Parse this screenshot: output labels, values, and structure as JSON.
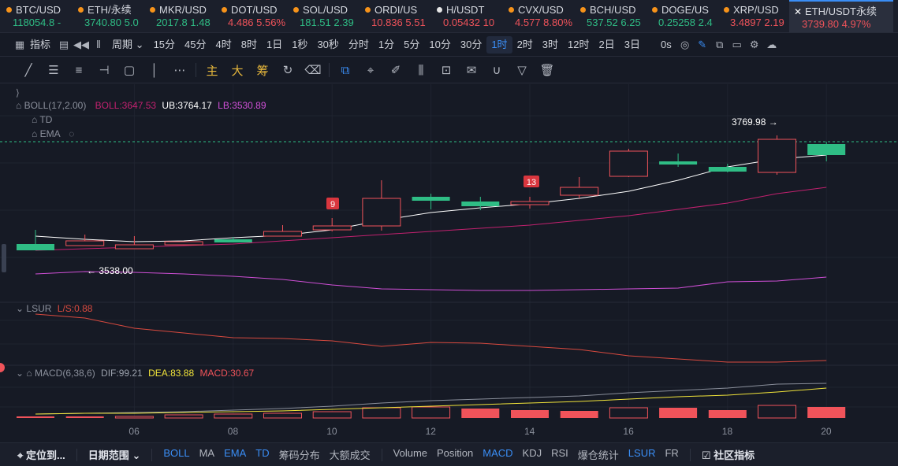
{
  "tickers": [
    {
      "name": "BTC/USD",
      "price": "118054.8 -",
      "dir": "up"
    },
    {
      "name": "ETH/永续",
      "price": "3740.80 5.0",
      "dir": "up"
    },
    {
      "name": "MKR/USD",
      "price": "2017.8 1.48",
      "dir": "up"
    },
    {
      "name": "DOT/USD",
      "price": "4.486 5.56%",
      "dir": "dn"
    },
    {
      "name": "SOL/USD",
      "price": "181.51 2.39",
      "dir": "up"
    },
    {
      "name": "ORDI/US",
      "price": "10.836 5.51",
      "dir": "dn"
    },
    {
      "name": "H/USDT",
      "price": "0.05432 10",
      "dir": "dn"
    },
    {
      "name": "CVX/USD",
      "price": "4.577 8.80%",
      "dir": "dn"
    },
    {
      "name": "BCH/USD",
      "price": "537.52 6.25",
      "dir": "up"
    },
    {
      "name": "DOGE/US",
      "price": "0.25258 2.4",
      "dir": "up"
    },
    {
      "name": "XRP/USD",
      "price": "3.4897 2.19",
      "dir": "dn"
    }
  ],
  "active_ticker": {
    "name": "ETH/USDT永续",
    "price": "3739.80 4.97%"
  },
  "toolbar": {
    "indicator_label": "指标",
    "period_label": "周期",
    "intervals": [
      "15分",
      "45分",
      "4时",
      "8时",
      "1日",
      "1秒",
      "30秒",
      "分时",
      "1分",
      "5分",
      "10分",
      "30分",
      "1时",
      "2时",
      "3时",
      "12时",
      "2日",
      "3日"
    ],
    "active_interval": "1时",
    "zero_s": "0s"
  },
  "drawing_tools": {
    "main": "主",
    "big": "大",
    "chip": "筹"
  },
  "chart_legend": {
    "boll_name": "BOLL(17,2.00)",
    "boll_val": "BOLL:3647.53",
    "ub_val": "UB:3764.17",
    "lb_val": "LB:3530.89",
    "td": "TD",
    "ema": "EMA",
    "lsur": "LSUR",
    "ls_val": "L/S:0.88",
    "macd_name": "MACD(6,38,6)",
    "dif_val": "DIF:99.21",
    "dea_val": "DEA:83.88",
    "macd_val": "MACD:30.67",
    "high_label": "3769.98",
    "low_label": "3538.00",
    "td9": "9",
    "td13": "13",
    "x_ticks": [
      "06",
      "08",
      "10",
      "12",
      "14",
      "16",
      "18",
      "20"
    ]
  },
  "colors": {
    "up": "#2fbd85",
    "down": "#f0535a",
    "accent": "#3a8ef6",
    "boll_mid": "#ffffff",
    "boll_ub": "#c2216f",
    "boll_lb": "#cf4fd6",
    "dea": "#f0e33a"
  },
  "candles": [
    {
      "dir": "up",
      "o": 4,
      "c": 12,
      "h": 30,
      "l": 15
    },
    {
      "dir": "dn",
      "o": 10,
      "c": 16,
      "h": 24,
      "l": 40
    },
    {
      "dir": "dn",
      "o": 6,
      "c": 11,
      "h": 22,
      "l": 8
    },
    {
      "dir": "dn",
      "o": 12,
      "c": 15,
      "h": 15,
      "l": 25
    },
    {
      "dir": "up",
      "o": 18,
      "c": 16,
      "h": 21,
      "l": 26
    },
    {
      "dir": "dn",
      "o": 22,
      "c": 28,
      "h": 36,
      "l": 24
    },
    {
      "dir": "dn",
      "o": 30,
      "c": 35,
      "h": 45,
      "l": 28
    },
    {
      "dir": "dn",
      "o": 35,
      "c": 70,
      "h": 93,
      "l": 29
    },
    {
      "dir": "up",
      "o": 72,
      "c": 67,
      "h": 76,
      "l": 56
    },
    {
      "dir": "up",
      "o": 66,
      "c": 60,
      "h": 72,
      "l": 55
    },
    {
      "dir": "dn",
      "o": 66,
      "c": 62,
      "h": 72,
      "l": 57
    },
    {
      "dir": "dn",
      "o": 74,
      "c": 84,
      "h": 97,
      "l": 70
    },
    {
      "dir": "dn",
      "o": 98,
      "c": 130,
      "h": 133,
      "l": 97
    },
    {
      "dir": "up",
      "o": 117,
      "c": 113,
      "h": 127,
      "l": 110
    },
    {
      "dir": "up",
      "o": 110,
      "c": 104,
      "h": 114,
      "l": 103
    },
    {
      "dir": "dn",
      "o": 103,
      "c": 145,
      "h": 150,
      "l": 100
    },
    {
      "dir": "up",
      "o": 139,
      "c": 125,
      "h": 142,
      "l": 117
    }
  ],
  "macd_bars": [
    {
      "dir": "up",
      "h": 2
    },
    {
      "dir": "up",
      "h": 2
    },
    {
      "dir": "dn",
      "h": 2
    },
    {
      "dir": "dn",
      "h": 4
    },
    {
      "dir": "dn",
      "h": 5
    },
    {
      "dir": "dn",
      "h": 6
    },
    {
      "dir": "dn",
      "h": 8
    },
    {
      "dir": "dn",
      "h": 13
    },
    {
      "dir": "dn",
      "h": 14
    },
    {
      "dir": "up",
      "h": 12
    },
    {
      "dir": "up",
      "h": 10
    },
    {
      "dir": "up",
      "h": 9
    },
    {
      "dir": "dn",
      "h": 13
    },
    {
      "dir": "up",
      "h": 13
    },
    {
      "dir": "up",
      "h": 10
    },
    {
      "dir": "dn",
      "h": 16
    },
    {
      "dir": "up",
      "h": 14
    }
  ],
  "bottom_bar": {
    "locate": "定位到...",
    "date_range": "日期范围",
    "items": [
      "BOLL",
      "MA",
      "EMA",
      "TD",
      "筹码分布",
      "大额成交"
    ],
    "active_items": [
      "BOLL",
      "EMA",
      "TD"
    ],
    "items2": [
      "Volume",
      "Position",
      "MACD",
      "KDJ",
      "RSI",
      "爆仓统计",
      "LSUR",
      "FR"
    ],
    "active_items2": [
      "MACD",
      "LSUR"
    ],
    "community": "社区指标"
  }
}
